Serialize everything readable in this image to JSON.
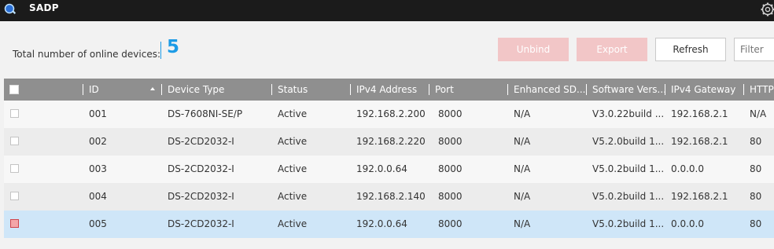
{
  "app": {
    "title": "SADP",
    "icons": {
      "app": "search-magnifier-icon",
      "settings": "gear-icon"
    }
  },
  "toolbar": {
    "online_label": "Total number of online devices:",
    "online_count": "5",
    "unbind_label": "Unbind",
    "export_label": "Export",
    "refresh_label": "Refresh",
    "filter_placeholder": "Filter",
    "colors": {
      "accent": "#1c9be6",
      "disabled_button": "#f2c6c7"
    }
  },
  "table": {
    "columns": [
      "ID",
      "Device Type",
      "Status",
      "IPv4 Address",
      "Port",
      "Enhanced SD...",
      "Software Vers...",
      "IPv4 Gateway",
      "HTTP"
    ],
    "sort": {
      "column": "ID",
      "direction": "ascending"
    },
    "rows": [
      {
        "id": "001",
        "device_type": "DS-7608NI-SE/P",
        "status": "Active",
        "ipv4": "192.168.2.200",
        "port": "8000",
        "enhanced_sdk": "N/A",
        "software": "V3.0.22build ...",
        "gateway": "192.168.2.1",
        "http": "N/A",
        "selected": false
      },
      {
        "id": "002",
        "device_type": "DS-2CD2032-I",
        "status": "Active",
        "ipv4": "192.168.2.220",
        "port": "8000",
        "enhanced_sdk": "N/A",
        "software": "V5.2.0build 1...",
        "gateway": "192.168.2.1",
        "http": "80",
        "selected": false
      },
      {
        "id": "003",
        "device_type": "DS-2CD2032-I",
        "status": "Active",
        "ipv4": "192.0.0.64",
        "port": "8000",
        "enhanced_sdk": "N/A",
        "software": "V5.0.2build 1...",
        "gateway": "0.0.0.0",
        "http": "80",
        "selected": false
      },
      {
        "id": "004",
        "device_type": "DS-2CD2032-I",
        "status": "Active",
        "ipv4": "192.168.2.140",
        "port": "8000",
        "enhanced_sdk": "N/A",
        "software": "V5.0.2build 1...",
        "gateway": "192.168.2.1",
        "http": "80",
        "selected": false
      },
      {
        "id": "005",
        "device_type": "DS-2CD2032-I",
        "status": "Active",
        "ipv4": "192.0.0.64",
        "port": "8000",
        "enhanced_sdk": "N/A",
        "software": "V5.0.2build 1...",
        "gateway": "0.0.0.0",
        "http": "80",
        "selected": true
      }
    ]
  }
}
